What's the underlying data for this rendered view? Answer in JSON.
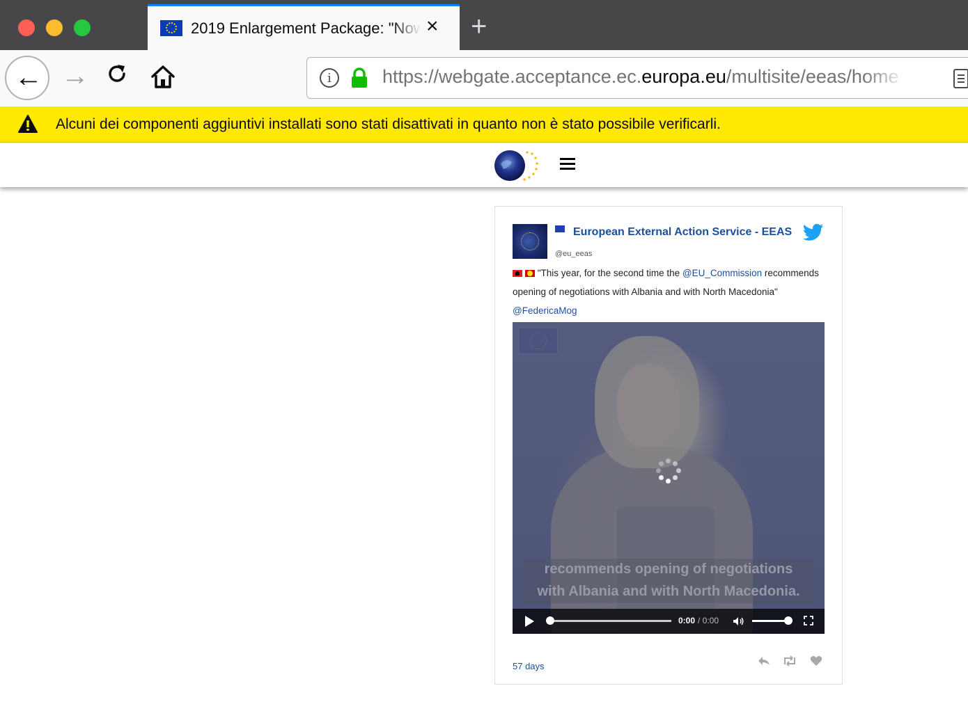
{
  "browser": {
    "tab_title": "2019 Enlargement Package: \"Now",
    "tab_close": "×",
    "new_tab": "+",
    "url_prefix": "https://webgate.acceptance.ec.",
    "url_domain": "europa.eu",
    "url_suffix": "/multisite/eeas/home"
  },
  "notification": {
    "text": "Alcuni dei componenti aggiuntivi installati sono stati disattivati in quanto non è stato possibile verificarli."
  },
  "tweet": {
    "author_name": "European External Action Service - EEAS",
    "handle": "@eu_eeas",
    "text_part1": "\"This year, for the second time the ",
    "mention1": "@EU_Commission",
    "text_part2": " recommends opening of negotiations with Albania and with North Macedonia\" ",
    "mention2": "@FedericaMog",
    "video": {
      "subtitle_line1": "recommends opening of negotiations",
      "subtitle_line2": "with Albania and with North Macedonia.",
      "current_time": "0:00",
      "duration": "/ 0:00",
      "progress": 0,
      "volume": 1
    },
    "date": "57 days"
  },
  "colors": {
    "notification_bg": "#ffe900",
    "link": "#1b4f9c",
    "tab_accent": "#0a84ff",
    "lock_green": "#12bc00"
  }
}
